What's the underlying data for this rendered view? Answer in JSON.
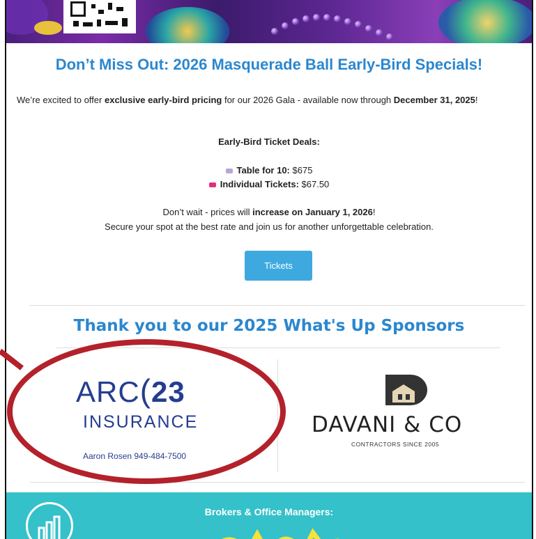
{
  "email": {
    "title": "Don’t Miss Out: 2026 Masquerade Ball Early-Bird Specials!",
    "intro_pre": "We’re excited to offer ",
    "intro_bold": "exclusive early-bird pricing",
    "intro_mid": " for our 2026 Gala - available now through ",
    "intro_date": "December 31, 2025",
    "intro_end": "!",
    "deals_heading": "Early-Bird Ticket Deals:",
    "deals": [
      {
        "label": "Table for 10:",
        "value": " $675",
        "color": "#b9a6d9"
      },
      {
        "label": "Individual Tickets:",
        "value": " $67.50",
        "color": "#e0307a"
      }
    ],
    "wait_pre": "Don’t wait - prices will ",
    "wait_bold": "increase on January 1, 2026",
    "wait_end": "!",
    "secure": "Secure your spot at the best rate and join us for another unforgettable celebration.",
    "button_label": "Tickets",
    "sponsor_heading": "Thank you to our 2025 What's Up Sponsors",
    "sponsors": {
      "arc_text": "ARC",
      "arc_num": "23",
      "arc_sub": "INSURANCE",
      "arc_contact": "Aaron Rosen  949-484-7500",
      "davani_name": "DAVANI & CO",
      "davani_tag": "CONTRACTORS SINCE 2005"
    },
    "footer_heading": "Brokers & Office Managers:"
  },
  "colors": {
    "accent_blue": "#2b87cf",
    "button": "#3ea9df",
    "highlight_circle": "#b3212b",
    "footer_teal": "#34c1c9"
  }
}
